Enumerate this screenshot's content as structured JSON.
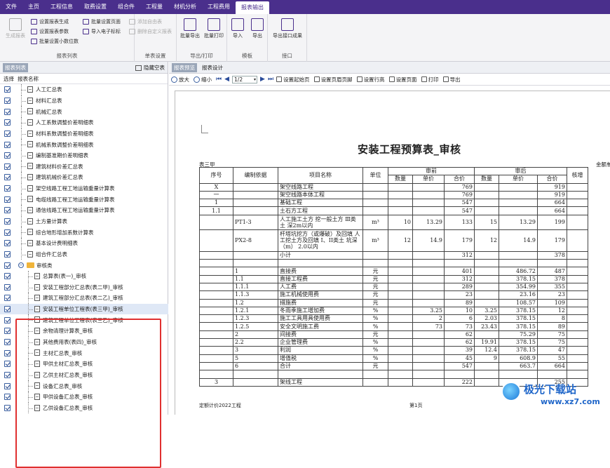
{
  "menubar": [
    "文件",
    "主页",
    "工程信息",
    "取费设置",
    "组合件",
    "工程量",
    "材机分析",
    "工程费用",
    "报表输出"
  ],
  "menubar_active": 8,
  "ribbon": {
    "groups": [
      {
        "label": "报表列表",
        "big": [
          {
            "label": "生成报表",
            "disabled": true
          }
        ],
        "small": [
          {
            "label": "设置报表生成",
            "disabled": false
          },
          {
            "label": "设置报表参数",
            "disabled": false
          },
          {
            "label": "批量设置小数位数",
            "disabled": false
          },
          {
            "label": "批量设置页面",
            "disabled": false
          },
          {
            "label": "导入电子标标",
            "disabled": false
          }
        ]
      },
      {
        "label": "单表设置",
        "small": [
          {
            "label": "添加自由表",
            "disabled": true
          },
          {
            "label": "删除自定义报表",
            "disabled": true
          }
        ]
      },
      {
        "label": "导出/打印",
        "big": [
          {
            "label": "批量导出",
            "disabled": false
          },
          {
            "label": "批量打印",
            "disabled": false
          }
        ]
      },
      {
        "label": "模板",
        "big": [
          {
            "label": "导入",
            "disabled": false
          },
          {
            "label": "导出",
            "disabled": false
          }
        ]
      },
      {
        "label": "接口",
        "big": [
          {
            "label": "导出接口成果",
            "disabled": false
          }
        ]
      }
    ]
  },
  "left": {
    "tab_active": "报表列表",
    "hide_label": "隐藏空表",
    "col_select": "选择",
    "col_name": "报表名称",
    "items": [
      {
        "label": "人工汇总表",
        "level": 1
      },
      {
        "label": "材料汇总表",
        "level": 1
      },
      {
        "label": "机械汇总表",
        "level": 1
      },
      {
        "label": "人工系数调整价差明细表",
        "level": 1
      },
      {
        "label": "材料系数调整价差明细表",
        "level": 1
      },
      {
        "label": "机械系数调整价差明细表",
        "level": 1
      },
      {
        "label": "编制基准期价差明细表",
        "level": 1
      },
      {
        "label": "建筑材料价差汇总表",
        "level": 1
      },
      {
        "label": "建筑机械价差汇总表",
        "level": 1
      },
      {
        "label": "架空线路工程工地运输重量计算表",
        "level": 1
      },
      {
        "label": "电缆线路工程工地运输重量计算表",
        "level": 1
      },
      {
        "label": "通信线路工程工地运输重量计算表",
        "level": 1
      },
      {
        "label": "土方量计算表",
        "level": 1
      },
      {
        "label": "综合地形增加系数计算表",
        "level": 1
      },
      {
        "label": "基本设计费明细表",
        "level": 1
      },
      {
        "label": "组合件汇总表",
        "level": 1
      },
      {
        "label": "审核类",
        "level": 0
      },
      {
        "label": "总算表(表一)_审核",
        "level": 2
      },
      {
        "label": "安装工程部分汇总表(表二甲)_审核",
        "level": 2
      },
      {
        "label": "建筑工程部分汇总表(表二乙)_审核",
        "level": 2
      },
      {
        "label": "安装工程单位工程表(表三甲)_审核",
        "level": 2,
        "selected": true
      },
      {
        "label": "建筑工程单位工程表(表三乙)_审核",
        "level": 2
      },
      {
        "label": "余物清理计算表_审核",
        "level": 2
      },
      {
        "label": "其他费用表(表四)_审核",
        "level": 2
      },
      {
        "label": "主材汇总表_审核",
        "level": 2
      },
      {
        "label": "甲供主材汇总表_审核",
        "level": 2
      },
      {
        "label": "乙供主材汇总表_审核",
        "level": 2
      },
      {
        "label": "设备汇总表_审核",
        "level": 2
      },
      {
        "label": "甲供设备汇总表_审核",
        "level": 2
      },
      {
        "label": "乙供设备汇总表_审核",
        "level": 2
      }
    ]
  },
  "right": {
    "tabs": [
      "报表预览",
      "报表设计"
    ],
    "tab_active": "报表预览",
    "toolbar": {
      "zoom_in": "放大",
      "zoom_out": "缩小",
      "page": "1/2",
      "start_page": "设置起始页",
      "header_footer": "设置页眉页脚",
      "row_height": "设置行高",
      "page_setup": "设置页面",
      "print": "打印",
      "export": "导出"
    },
    "sheet": {
      "title": "安装工程预算表_审核",
      "name": "表三甲",
      "level": "金额单",
      "headers": {
        "no": "序号",
        "basis": "编制依据",
        "item": "项目名称",
        "unit": "单位",
        "before": "审前",
        "after": "审后",
        "qty": "数量",
        "price": "单价",
        "total": "合价",
        "diff": "核增"
      },
      "rows": [
        {
          "no": "X",
          "basis": "",
          "item": "架空线路工程",
          "unit": "",
          "q1": "",
          "p1": "",
          "t1": "769",
          "q2": "",
          "p2": "",
          "t2": "919"
        },
        {
          "no": "一",
          "basis": "",
          "item": "架空线路本体工程",
          "unit": "",
          "q1": "",
          "p1": "",
          "t1": "769",
          "q2": "",
          "p2": "",
          "t2": "919"
        },
        {
          "no": "1",
          "basis": "",
          "item": "基础工程",
          "unit": "",
          "q1": "",
          "p1": "",
          "t1": "547",
          "q2": "",
          "p2": "",
          "t2": "664"
        },
        {
          "no": "1.1",
          "basis": "",
          "item": "土石方工程",
          "unit": "",
          "q1": "",
          "p1": "",
          "t1": "547",
          "q2": "",
          "p2": "",
          "t2": "664"
        },
        {
          "no": "",
          "basis": "PT1-3",
          "item": "人工施工土方 挖一般土方 Ⅲ类土 深2m以内",
          "unit": "m³",
          "q1": "10",
          "p1": "13.29",
          "t1": "133",
          "q2": "15",
          "p2": "13.29",
          "t2": "199",
          "tall": 2
        },
        {
          "no": "",
          "basis": "PX2-8",
          "item": "杆塔坑挖方（或爆破）及回填 人工挖土方及回填 I、II类土 坑深（m） 2.0以内",
          "unit": "m³",
          "q1": "12",
          "p1": "14.9",
          "t1": "179",
          "q2": "12",
          "p2": "14.9",
          "t2": "179",
          "tall": 3
        },
        {
          "no": "",
          "basis": "",
          "item": "小计",
          "unit": "",
          "q1": "",
          "p1": "",
          "t1": "312",
          "q2": "",
          "p2": "",
          "t2": "378"
        },
        {
          "no": "",
          "basis": "",
          "item": "",
          "unit": "",
          "q1": "",
          "p1": "",
          "t1": "",
          "q2": "",
          "p2": "",
          "t2": ""
        },
        {
          "no": "",
          "basis": "1",
          "item": "直接费",
          "unit": "元",
          "q1": "",
          "p1": "",
          "t1": "401",
          "q2": "",
          "p2": "486.72",
          "t2": "487"
        },
        {
          "no": "",
          "basis": "1.1",
          "item": "直接工程费",
          "unit": "元",
          "q1": "",
          "p1": "",
          "t1": "312",
          "q2": "",
          "p2": "378.15",
          "t2": "378"
        },
        {
          "no": "",
          "basis": "1.1.1",
          "item": "人工费",
          "unit": "元",
          "q1": "",
          "p1": "",
          "t1": "289",
          "q2": "",
          "p2": "354.99",
          "t2": "355"
        },
        {
          "no": "",
          "basis": "1.1.3",
          "item": "施工机械使用费",
          "unit": "元",
          "q1": "",
          "p1": "",
          "t1": "23",
          "q2": "",
          "p2": "23.16",
          "t2": "23"
        },
        {
          "no": "",
          "basis": "1.2",
          "item": "措施费",
          "unit": "元",
          "q1": "",
          "p1": "",
          "t1": "89",
          "q2": "",
          "p2": "108.57",
          "t2": "109"
        },
        {
          "no": "",
          "basis": "1.2.1",
          "item": "冬雨季施工增加费",
          "unit": "%",
          "q1": "",
          "p1": "3.25",
          "t1": "10",
          "q2": "3.25",
          "p2": "378.15",
          "t2": "12"
        },
        {
          "no": "",
          "basis": "1.2.3",
          "item": "施工工具用具使用费",
          "unit": "%",
          "q1": "",
          "p1": "2",
          "t1": "6",
          "q2": "2.03",
          "p2": "378.15",
          "t2": "8"
        },
        {
          "no": "",
          "basis": "1.2.5",
          "item": "安全文明施工费",
          "unit": "%",
          "q1": "",
          "p1": "73",
          "t1": "73",
          "q2": "23.43",
          "p2": "378.15",
          "t2": "89"
        },
        {
          "no": "",
          "basis": "2",
          "item": "间接费",
          "unit": "元",
          "q1": "",
          "p1": "",
          "t1": "62",
          "q2": "",
          "p2": "75.29",
          "t2": "75"
        },
        {
          "no": "",
          "basis": "2.2",
          "item": "企业管理费",
          "unit": "%",
          "q1": "",
          "p1": "",
          "t1": "62",
          "q2": "19.91",
          "p2": "378.15",
          "t2": "75"
        },
        {
          "no": "",
          "basis": "3",
          "item": "利润",
          "unit": "%",
          "q1": "",
          "p1": "",
          "t1": "39",
          "q2": "12.4",
          "p2": "378.15",
          "t2": "47"
        },
        {
          "no": "",
          "basis": "5",
          "item": "增值税",
          "unit": "%",
          "q1": "",
          "p1": "",
          "t1": "45",
          "q2": "9",
          "p2": "608.9",
          "t2": "55"
        },
        {
          "no": "",
          "basis": "6",
          "item": "合计",
          "unit": "元",
          "q1": "",
          "p1": "",
          "t1": "547",
          "q2": "",
          "p2": "663.7",
          "t2": "664"
        },
        {
          "no": "",
          "basis": "",
          "item": "",
          "unit": "",
          "q1": "",
          "p1": "",
          "t1": "",
          "q2": "",
          "p2": "",
          "t2": ""
        },
        {
          "no": "3",
          "basis": "",
          "item": "架线工程",
          "unit": "",
          "q1": "",
          "p1": "",
          "t1": "222",
          "q2": "",
          "p2": "",
          "t2": "255"
        }
      ],
      "footer_left": "定额计价2022工程",
      "footer_center": "第1页"
    }
  },
  "watermark": {
    "title": "极光下载站",
    "url": "www.xz7.com"
  }
}
